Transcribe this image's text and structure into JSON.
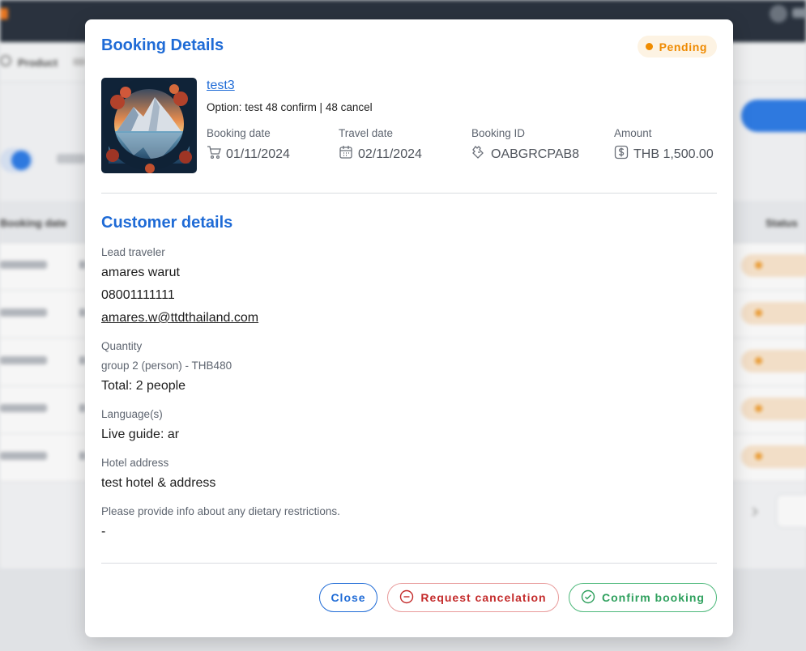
{
  "background": {
    "breadcrumb": "Product",
    "table_header_first": "Booking date",
    "table_header_last": "Status",
    "row_count": 5
  },
  "modal": {
    "title": "Booking Details",
    "status": "Pending",
    "product_image_icon": "mountain-lake-landscape-image",
    "product_name": "test3",
    "option": "Option: test 48 confirm | 48 cancel",
    "info": [
      {
        "label": "Booking date",
        "value": "01/11/2024",
        "icon": "cart-icon"
      },
      {
        "label": "Travel date",
        "value": "02/11/2024",
        "icon": "calendar-icon"
      },
      {
        "label": "Booking ID",
        "value": "OABGRCPAB8",
        "icon": "ticket-icon"
      },
      {
        "label": "Amount",
        "value": "THB 1,500.00",
        "icon": "dollar-icon"
      }
    ],
    "customer": {
      "title": "Customer details",
      "lead_label": "Lead traveler",
      "lead_name": "amares warut",
      "lead_phone": "08001111111",
      "lead_email": "amares.w@ttdthailand.com",
      "quantity_label": "Quantity",
      "quantity_detail": "group 2 (person) - THB480",
      "quantity_total": "Total: 2 people",
      "language_label": "Language(s)",
      "language_value": "Live guide: ar",
      "hotel_label": "Hotel address",
      "hotel_value": "test hotel & address",
      "dietary_label": "Please provide info about any dietary restrictions.",
      "dietary_value": "-"
    },
    "buttons": {
      "close": "Close",
      "cancel": "Request cancelation",
      "confirm": "Confirm booking"
    },
    "colors": {
      "accent": "#1f6bd6",
      "pending": "#ef8a00",
      "danger": "#c42b2b",
      "success": "#2ea05d"
    }
  }
}
